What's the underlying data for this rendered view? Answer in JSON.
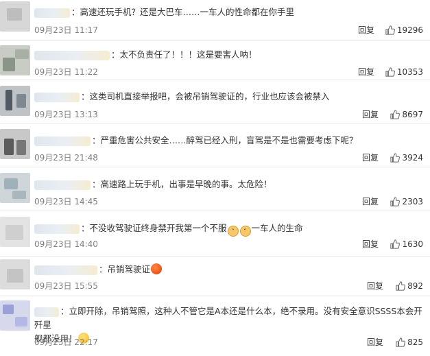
{
  "comments": [
    {
      "prefix": "：",
      "text": "高速还玩手机？还是大巴车……一车人的性命都在你手里",
      "time": "09月23日 11:17",
      "reply": "回复",
      "likes": "19296"
    },
    {
      "prefix": "：",
      "text": "太不负责任了！！！这是要害人呐！",
      "time": "09月23日 11:22",
      "reply": "回复",
      "likes": "10353"
    },
    {
      "prefix": "：",
      "text": "这类司机直接举报吧，会被吊销驾驶证的，行业也应该会被禁入",
      "time": "09月23日 13:13",
      "reply": "回复",
      "likes": "8697"
    },
    {
      "prefix": "：",
      "text": "严重危害公共安全……醉驾已经入刑，盲驾是不是也需要考虑下呢？",
      "time": "09月23日 21:48",
      "reply": "回复",
      "likes": "3924"
    },
    {
      "prefix": "：",
      "text": "高速路上玩手机，出事是早晚的事。太危险！",
      "time": "09月23日 14:45",
      "reply": "回复",
      "likes": "2303"
    },
    {
      "prefix": "：",
      "text_a": "不没收驾驶证终身禁开我第一个不服",
      "text_b": "一车人的生命",
      "time": "09月23日 14:40",
      "reply": "回复",
      "likes": "1630"
    },
    {
      "prefix": "：",
      "text": "吊销驾驶证",
      "time": "09月23日 15:55",
      "reply": "回复",
      "likes": "892"
    },
    {
      "prefix": "：",
      "text_line1": "立即开除，吊销驾照，这种人不管它是A本还是什么本，绝不录用。没有安全意识SSSS本会开歼星",
      "text_line2": "舰都没用！",
      "time": "09月23日 22:17",
      "reply": "回复",
      "likes": "825"
    }
  ],
  "icons": {
    "like": "thumbs-up-icon",
    "emoji_angry": "angry-face-icon",
    "emoji_cat": "cat-face-icon",
    "emoji_tired": "tired-face-icon"
  }
}
